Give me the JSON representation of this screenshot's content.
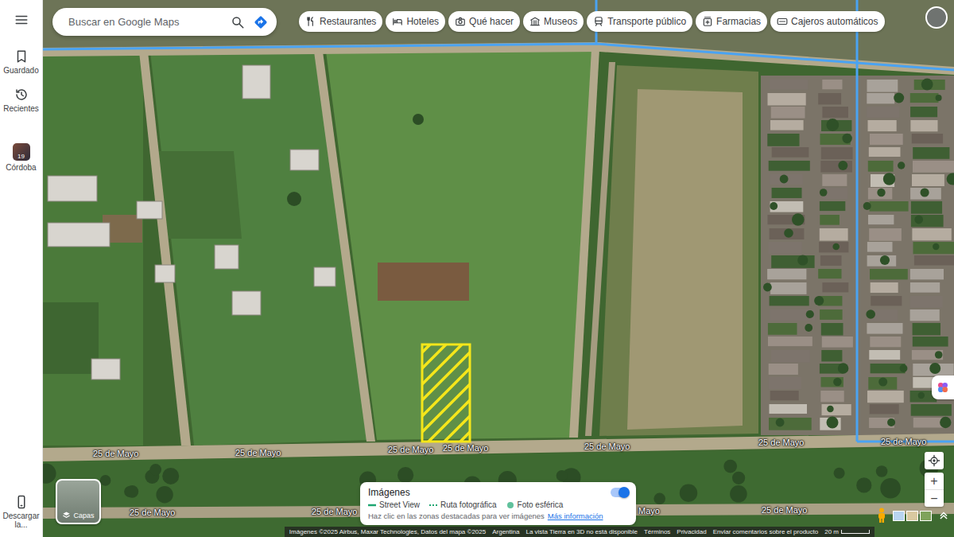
{
  "search": {
    "placeholder": "Buscar en Google Maps"
  },
  "chips": [
    {
      "label": "Restaurantes"
    },
    {
      "label": "Hoteles"
    },
    {
      "label": "Qué hacer"
    },
    {
      "label": "Museos"
    },
    {
      "label": "Transporte público"
    },
    {
      "label": "Farmacias"
    },
    {
      "label": "Cajeros automáticos"
    }
  ],
  "sidebar": {
    "items": [
      {
        "label": "Guardado"
      },
      {
        "label": "Recientes"
      },
      {
        "label": "Córdoba",
        "badge": "19"
      }
    ],
    "download": "Descargar la..."
  },
  "layers": {
    "label": "Capas"
  },
  "street_labels": [
    "25 de Mayo",
    "25 de Mayo",
    "25 de Mayo",
    "25 de Mayo",
    "25 de Mayo",
    "25 de Mayo",
    "25 de Mayo",
    "25 de Mayo",
    "25 de Mayo",
    "Mayo",
    "25 de Mayo"
  ],
  "imagery_panel": {
    "title": "Imágenes",
    "on": true,
    "legend": [
      {
        "label": "Street View",
        "kind": "line"
      },
      {
        "label": "Ruta fotográfica",
        "kind": "dashed"
      },
      {
        "label": "Foto esférica",
        "kind": "dot"
      }
    ],
    "hint": "Haz clic en las zonas destacadas para ver imágenes",
    "link": "Más información"
  },
  "zoom": {
    "in": "+",
    "out": "−"
  },
  "footer": {
    "attribution": "Imágenes ©2025 Airbus, Maxar Technologies, Datos del mapa ©2025",
    "items": [
      "Argentina",
      "La vista Tierra en 3D no está disponible",
      "Términos",
      "Privacidad",
      "Enviar comentarios sobre el producto"
    ],
    "scale": "20 m"
  }
}
